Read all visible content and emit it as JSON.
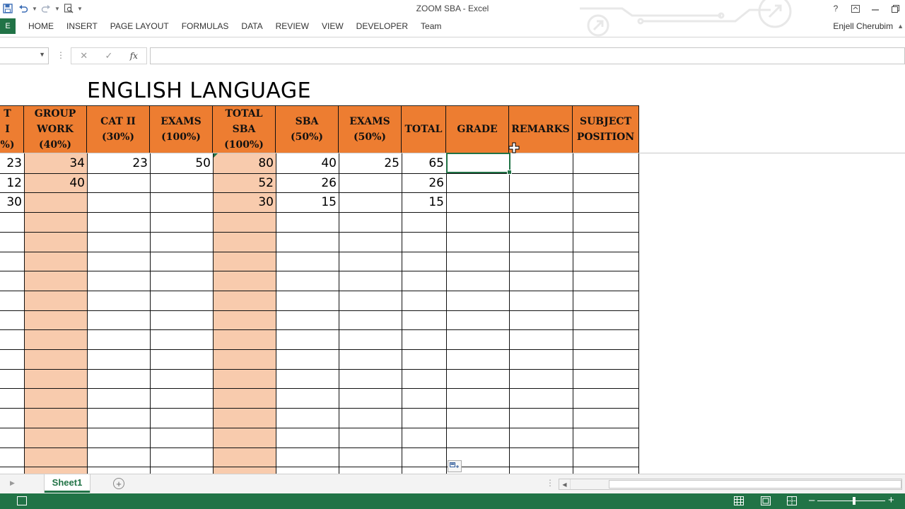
{
  "window": {
    "title": "ZOOM  SBA - Excel",
    "user_name": "Enjell Cherubim"
  },
  "ribbon": {
    "file_tab": "E",
    "tabs": [
      "HOME",
      "INSERT",
      "PAGE LAYOUT",
      "FORMULAS",
      "DATA",
      "REVIEW",
      "VIEW",
      "DEVELOPER",
      "Team"
    ]
  },
  "formula_bar": {
    "name_box": "",
    "formula": ""
  },
  "sheet": {
    "title": "ENGLISH LANGUAGE",
    "headers": [
      "T I\n%)",
      "GROUP\nWORK\n(40%)",
      "CAT II\n(30%)",
      "EXAMS\n(100%)",
      "TOTAL\nSBA\n(100%)",
      "SBA\n(50%)",
      "EXAMS\n(50%)",
      "TOTAL",
      "GRADE",
      "REMARKS",
      "SUBJECT\nPOSITION"
    ],
    "rows": [
      [
        "23",
        "34",
        "23",
        "50",
        "80",
        "40",
        "25",
        "65",
        "",
        "",
        ""
      ],
      [
        "12",
        "40",
        "",
        "",
        "52",
        "26",
        "",
        "26",
        "",
        "",
        ""
      ],
      [
        "30",
        "",
        "",
        "",
        "30",
        "15",
        "",
        "15",
        "",
        "",
        ""
      ]
    ]
  },
  "sheet_tabs": {
    "active": "Sheet1"
  },
  "colors": {
    "header_fill": "#ed7d31",
    "highlight_fill": "#f8cbad",
    "accent": "#217346"
  }
}
